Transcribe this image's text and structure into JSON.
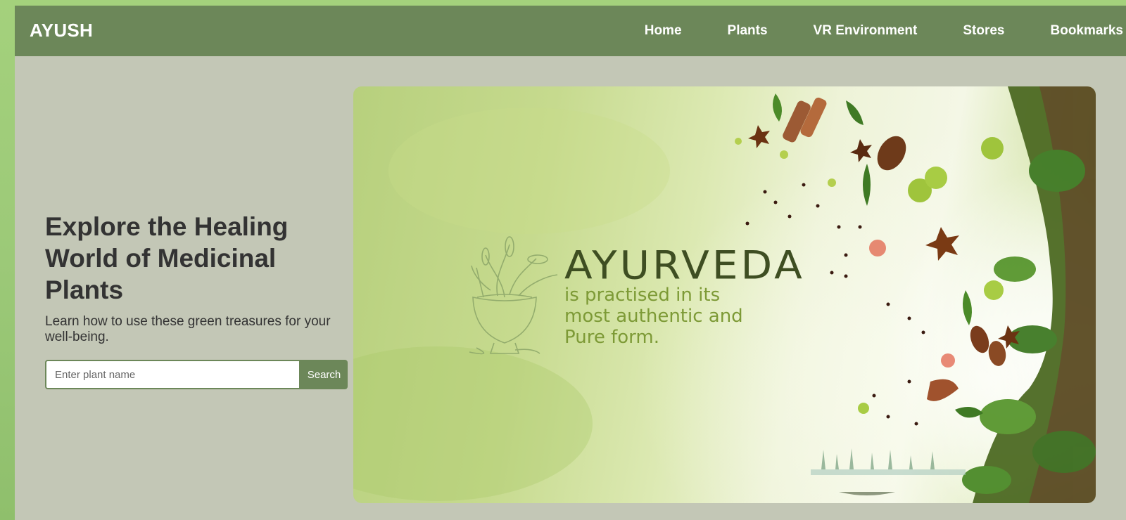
{
  "navbar": {
    "brand": "AYUSH",
    "links": [
      {
        "label": "Home"
      },
      {
        "label": "Plants"
      },
      {
        "label": "VR Environment"
      },
      {
        "label": "Stores"
      },
      {
        "label": "Bookmarks"
      }
    ]
  },
  "hero": {
    "title_lines": [
      "Explore the Healing",
      "World of Medicinal",
      "Plants"
    ],
    "subtitle": "Learn how to use these green treasures for your well-being.",
    "search": {
      "placeholder": "Enter plant name",
      "value": "",
      "button_label": "Search"
    }
  },
  "banner": {
    "title": "AYURVEDA",
    "tagline_lines": [
      "is practised in its",
      "most authentic and",
      "Pure form."
    ]
  },
  "colors": {
    "outer_background": "#a4d17c",
    "page_background": "#c3c7b6",
    "navbar": "#6c8759",
    "text_dark": "#333333",
    "banner_title": "#3e4e22",
    "banner_tagline": "#7d9a36"
  }
}
